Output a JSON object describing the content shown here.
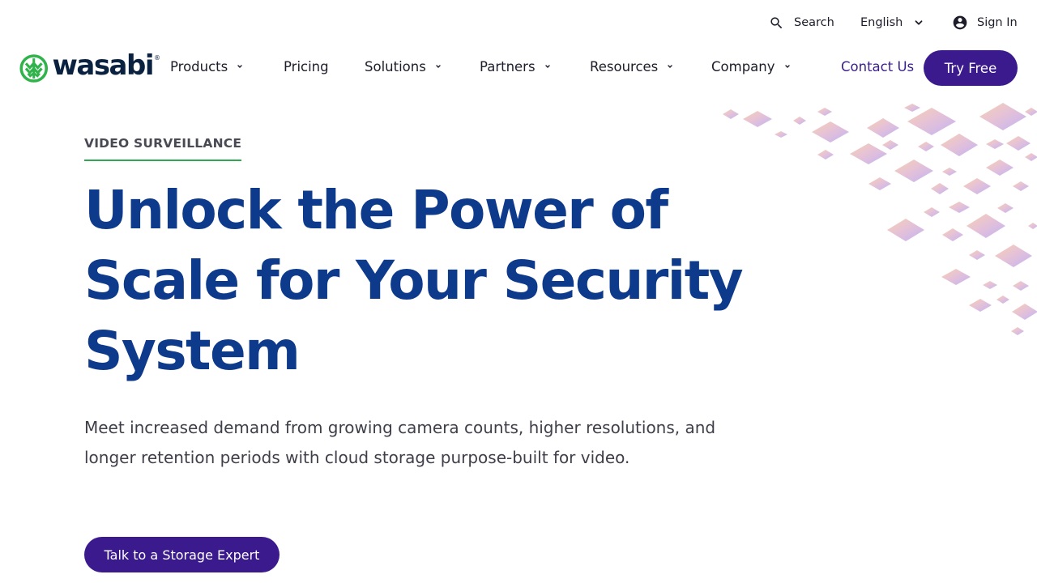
{
  "utility_bar": {
    "search_label": "Search",
    "search_icon": "search-icon",
    "language_label": "English",
    "signin_label": "Sign In",
    "signin_icon": "account-circle-icon"
  },
  "brand": {
    "name": "wasabi",
    "registered_mark": "®",
    "green": "#2fb34a",
    "navy": "#0a2240"
  },
  "nav": {
    "items": [
      {
        "label": "Products",
        "has_dropdown": true
      },
      {
        "label": "Pricing",
        "has_dropdown": false
      },
      {
        "label": "Solutions",
        "has_dropdown": true
      },
      {
        "label": "Partners",
        "has_dropdown": true
      },
      {
        "label": "Resources",
        "has_dropdown": true
      },
      {
        "label": "Company",
        "has_dropdown": true
      }
    ],
    "contact_label": "Contact Us",
    "try_label": "Try Free"
  },
  "hero": {
    "eyebrow": "VIDEO SURVEILLANCE",
    "headline_line1": "Unlock the Power of",
    "headline_line2": "Scale for Your Security",
    "headline_line3": "System",
    "lede": "Meet increased demand from growing camera counts, higher resolutions, and longer retention periods with cloud storage purpose-built for video.",
    "cta_label": "Talk to a Storage Expert"
  },
  "colors": {
    "accent_purple": "#3a1a8c",
    "headline_blue": "#0e3a8c",
    "eyebrow_underline": "#2fa84f",
    "text_dark": "#1d1d2b"
  }
}
